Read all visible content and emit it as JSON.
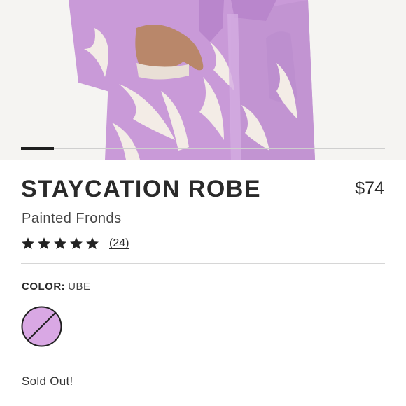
{
  "product": {
    "title": "STAYCATION ROBE",
    "price": "$74",
    "subtitle": "Painted Fronds",
    "rating": 5,
    "review_count": "(24)"
  },
  "gallery": {
    "image_subject": "robe-photo",
    "progress_fraction": 0.09
  },
  "color": {
    "label": "COLOR:",
    "value": "UBE",
    "swatch_hex": "#d9a8e4",
    "swatch_state": "sold-out"
  },
  "status": {
    "text": "Sold Out!"
  },
  "colors": {
    "robe": "#c99ad8",
    "frond": "#f3ece6",
    "skin": "#b9876a"
  }
}
